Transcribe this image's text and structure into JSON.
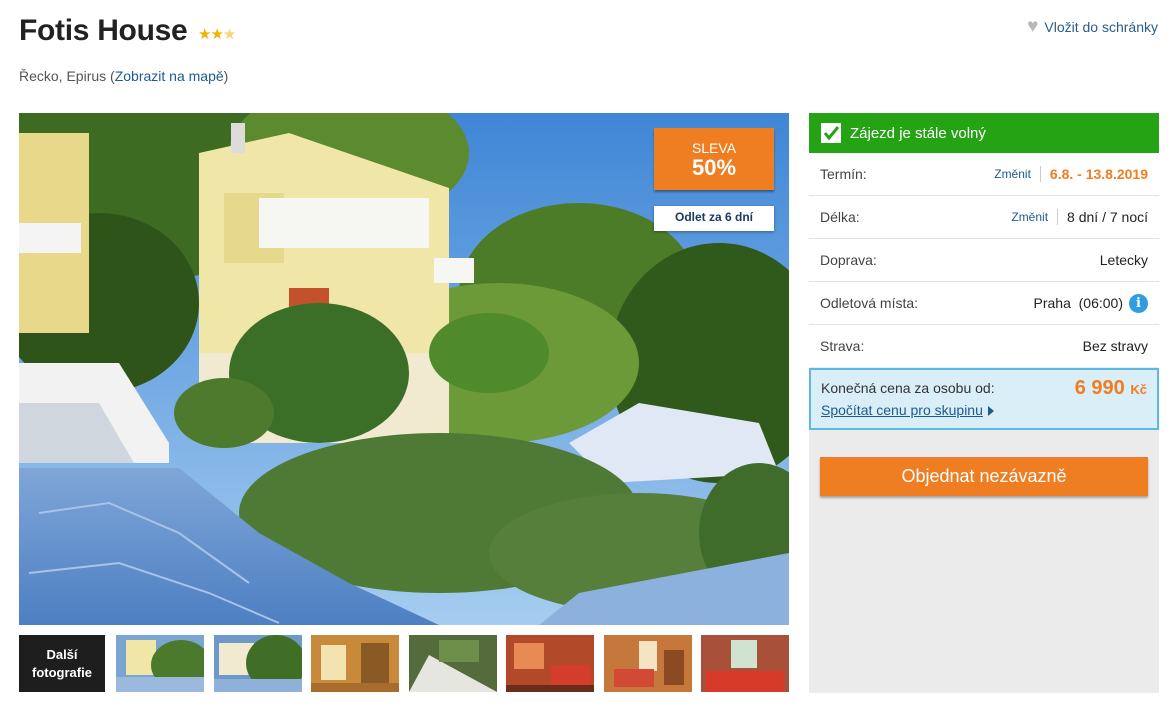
{
  "hotel": {
    "name": "Fotis House",
    "stars": "★★★",
    "location_prefix": "Řecko, Epirus (",
    "map_link": "Zobrazit na mapě",
    "location_suffix": ")"
  },
  "favorite_label": "Vložit do schránky",
  "photo": {
    "discount_label": "SLEVA",
    "discount_value": "50%",
    "departure_badge": "Odlet za 6 dní"
  },
  "gallery": {
    "more_label_1": "Další",
    "more_label_2": "fotografie"
  },
  "booking": {
    "status": "Zájezd je stále volný",
    "change_label": "Změnit",
    "rows": [
      {
        "label": "Termín:",
        "value": "6.8. - 13.8.2019"
      },
      {
        "label": "Délka:",
        "value": "8 dní / 7 nocí"
      },
      {
        "label": "Doprava:",
        "value": "Letecky"
      },
      {
        "label": "Odletová místa:",
        "value": "Praha  (06:00)"
      },
      {
        "label": "Strava:",
        "value": "Bez stravy"
      }
    ],
    "info_icon": "i",
    "price_label": "Konečná cena za osobu od:",
    "price_value": "6 990",
    "price_currency": "Kč",
    "group_link": "Spočítat cenu pro skupinu",
    "order_button": "Objednat nezávazně"
  },
  "colors": {
    "accent_orange": "#ef7d22",
    "status_green": "#26a215",
    "link_blue": "#1f5a8c",
    "price_box": "#d9eef7"
  },
  "icons": [
    "heart-icon",
    "checkbox-check-icon",
    "info-icon",
    "triangle-right-icon",
    "star-icon"
  ]
}
